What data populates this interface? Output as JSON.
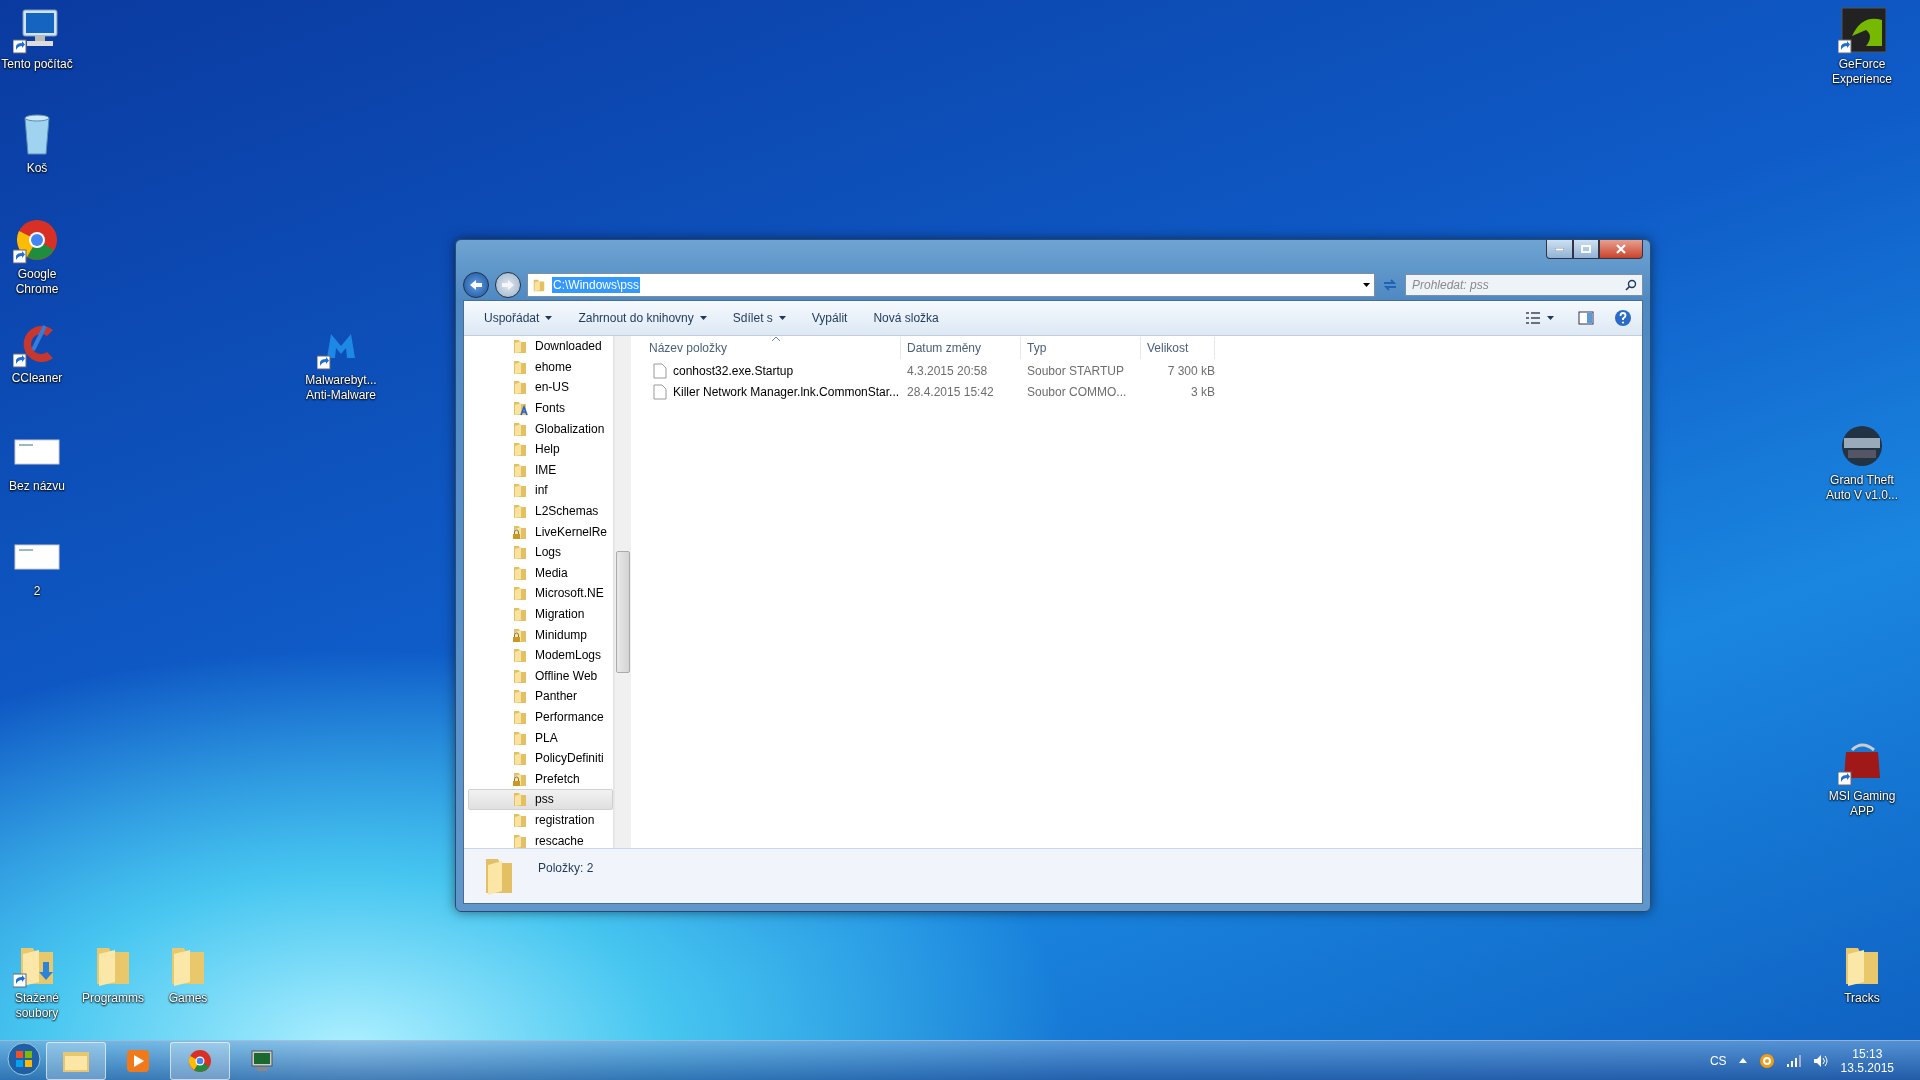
{
  "desktop_icons": [
    {
      "label": "Tento počítač",
      "kind": "computer",
      "shortcut": true
    },
    {
      "label": "Koš",
      "kind": "trash",
      "shortcut": false
    },
    {
      "label": "Google Chrome",
      "kind": "chrome",
      "shortcut": true
    },
    {
      "label": "CCleaner",
      "kind": "ccleaner",
      "shortcut": true
    },
    {
      "label": "Bez názvu",
      "kind": "document",
      "shortcut": false
    },
    {
      "label": "2",
      "kind": "document",
      "shortcut": false
    },
    {
      "label": "Malwarebyt... Anti-Malware",
      "kind": "malware",
      "shortcut": true
    },
    {
      "label": "Stažené soubory",
      "kind": "download",
      "shortcut": true
    },
    {
      "label": "Programms",
      "kind": "folder",
      "shortcut": false
    },
    {
      "label": "Games",
      "kind": "folder",
      "shortcut": false
    },
    {
      "label": "GeForce Experience",
      "kind": "geforce",
      "shortcut": true
    },
    {
      "label": "Grand Theft Auto V v1.0...",
      "kind": "trainer",
      "shortcut": false
    },
    {
      "label": "MSI Gaming APP",
      "kind": "msi",
      "shortcut": true
    },
    {
      "label": "Tracks",
      "kind": "folder",
      "shortcut": false
    }
  ],
  "window": {
    "address": "C:\\Windows\\pss",
    "search": {
      "placeholder": "Prohledat: pss"
    },
    "toolbar": [
      {
        "label": "Uspořádat",
        "has_menu": true
      },
      {
        "label": "Zahrnout do knihovny",
        "has_menu": true
      },
      {
        "label": "Sdílet s",
        "has_menu": true
      },
      {
        "label": "Vypálit",
        "has_menu": false
      },
      {
        "label": "Nová složka",
        "has_menu": false
      }
    ],
    "tree": [
      {
        "label": "Downloaded",
        "kind": "folder",
        "selected": false
      },
      {
        "label": "ehome",
        "kind": "folder",
        "selected": false
      },
      {
        "label": "en-US",
        "kind": "folder",
        "selected": false
      },
      {
        "label": "Fonts",
        "kind": "fonts",
        "selected": false
      },
      {
        "label": "Globalization",
        "kind": "folder",
        "selected": false
      },
      {
        "label": "Help",
        "kind": "folder",
        "selected": false
      },
      {
        "label": "IME",
        "kind": "folder",
        "selected": false
      },
      {
        "label": "inf",
        "kind": "folder",
        "selected": false
      },
      {
        "label": "L2Schemas",
        "kind": "folder",
        "selected": false
      },
      {
        "label": "LiveKernelRe",
        "kind": "locked",
        "selected": false
      },
      {
        "label": "Logs",
        "kind": "folder",
        "selected": false
      },
      {
        "label": "Media",
        "kind": "folder",
        "selected": false
      },
      {
        "label": "Microsoft.NE",
        "kind": "folder",
        "selected": false
      },
      {
        "label": "Migration",
        "kind": "folder",
        "selected": false
      },
      {
        "label": "Minidump",
        "kind": "locked",
        "selected": false
      },
      {
        "label": "ModemLogs",
        "kind": "folder",
        "selected": false
      },
      {
        "label": "Offline Web",
        "kind": "folder",
        "selected": false
      },
      {
        "label": "Panther",
        "kind": "folder",
        "selected": false
      },
      {
        "label": "Performance",
        "kind": "folder",
        "selected": false
      },
      {
        "label": "PLA",
        "kind": "folder",
        "selected": false
      },
      {
        "label": "PolicyDefiniti",
        "kind": "folder",
        "selected": false
      },
      {
        "label": "Prefetch",
        "kind": "locked",
        "selected": false
      },
      {
        "label": "pss",
        "kind": "folder",
        "selected": true
      },
      {
        "label": "registration",
        "kind": "folder",
        "selected": false
      },
      {
        "label": "rescache",
        "kind": "folder",
        "selected": false
      }
    ],
    "columns": [
      {
        "label": "Název položky",
        "sorted": true
      },
      {
        "label": "Datum změny",
        "sorted": false
      },
      {
        "label": "Typ",
        "sorted": false
      },
      {
        "label": "Velikost",
        "sorted": false
      }
    ],
    "files": [
      {
        "name": "conhost32.exe.Startup",
        "date": "4.3.2015 20:58",
        "type": "Soubor STARTUP",
        "size": "7 300 kB"
      },
      {
        "name": "Killer Network Manager.lnk.CommonStar...",
        "date": "28.4.2015 15:42",
        "type": "Soubor COMMO...",
        "size": "3 kB"
      }
    ],
    "status": "Položky: 2"
  },
  "taskbar": {
    "apps": [
      {
        "kind": "explorer",
        "active": true
      },
      {
        "kind": "media",
        "active": false
      },
      {
        "kind": "chrome",
        "active": true
      },
      {
        "kind": "monitor",
        "active": false
      }
    ],
    "language": "CS",
    "time": "15:13",
    "date": "13.5.2015"
  }
}
